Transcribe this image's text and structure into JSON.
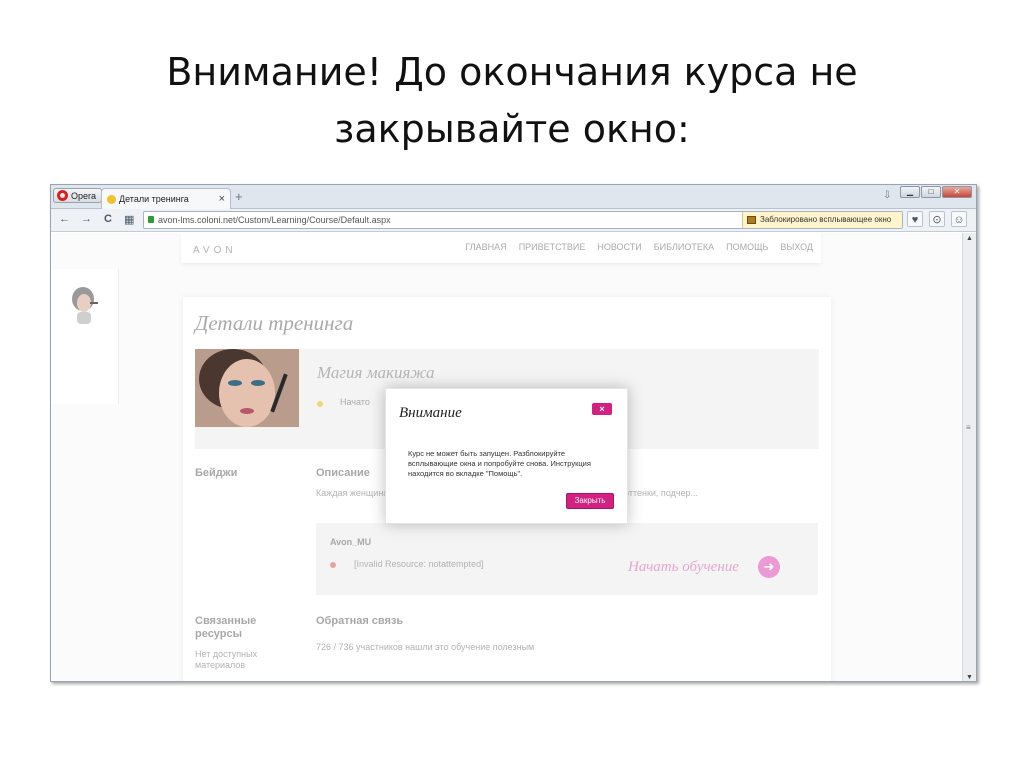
{
  "slide": {
    "title": "Внимание! До окончания курса не закрывайте окно:"
  },
  "browser": {
    "menu_label": "Opera",
    "tab_title": "Детали тренинга",
    "tab_close": "×",
    "new_tab": "+",
    "tab_menu": "⇩",
    "url": "avon-lms.coloni.net/Custom/Learning/Course/Default.aspx",
    "popup_notice": "Заблокировано всплывающее окно",
    "window_buttons": {
      "minimize": "▁",
      "maximize": "□",
      "close": "✕"
    },
    "nav_icons": {
      "back": "←",
      "forward": "→",
      "reload": "C",
      "speed_dial": "▦"
    },
    "right_icons": {
      "favorite": "♥",
      "download": "⊙",
      "account": "☺"
    }
  },
  "site": {
    "logo": "AVON",
    "nav": [
      "ГЛАВНАЯ",
      "ПРИВЕТСТВИЕ",
      "НОВОСТИ",
      "БИБЛИОТЕКА",
      "ПОМОЩЬ",
      "ВЫХОД"
    ]
  },
  "training": {
    "page_title": "Детали тренинга",
    "course_name": "Магия макияжа",
    "course_status": "Начато",
    "badges_label": "Бейджи",
    "description_label": "Описание",
    "description_text": "Каждая женщина ... возможность определить свой цветотип и подбирать оттенки, подчер...",
    "module_name": "Avon_MU",
    "module_status": "[Invalid Resource: notattempted]",
    "start_label": "Начать обучение",
    "related_label": "Связанные ресурсы",
    "related_note": "Нет доступных материалов",
    "feedback_label": "Обратная связь",
    "feedback_text": "726 / 736 участников нашли это обучение полезным"
  },
  "modal": {
    "title": "Внимание",
    "close_icon_glyph": "×",
    "message": "Курс не может быть запущен. Разблокируйте всплывающие окна и попробуйте снова. Инструкция находится во вкладке \"Помощь\".",
    "button_label": "Закрыть"
  },
  "colors": {
    "accent": "#d32182",
    "start_pink": "#ec9ad4",
    "popup_bar": "#fff5cc"
  }
}
